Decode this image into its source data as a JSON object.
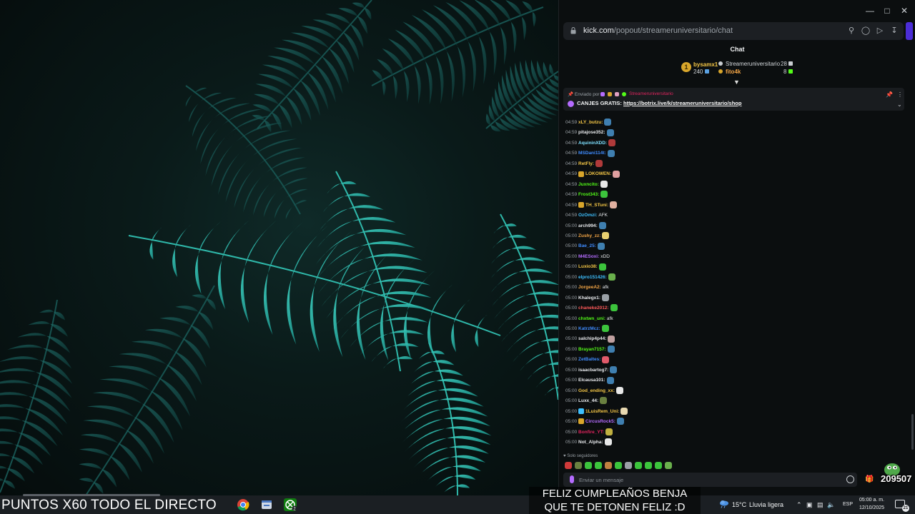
{
  "browser": {
    "url_host": "kick.com",
    "url_path": "/popout/streameruniversitario/chat"
  },
  "chat": {
    "title": "Chat",
    "leaderboard": {
      "rank": "1",
      "left_name": "bysamx1",
      "left_count": "240",
      "right_top_name": "Streameruniversitario",
      "right_top_count": "28",
      "right_bottom_name": "fito4k",
      "right_bottom_count": "8"
    },
    "pinned": {
      "sent_by": "Enviado por",
      "sent_by_user": "Streameruniversitario",
      "label": "CANJES GRATIS:",
      "link": "https://botrix.live/k/streameruniversitario/shop"
    },
    "messages": [
      {
        "time": "04:59",
        "user": "xLY_butzu:",
        "color": "#f4c646",
        "text": "",
        "emote": "#3f7fb0",
        "badge": ""
      },
      {
        "time": "04:59",
        "user": "pitajose352:",
        "color": "#e8eaed",
        "text": "",
        "emote": "#3f7fb0",
        "badge": ""
      },
      {
        "time": "04:59",
        "user": "AquininXDD:",
        "color": "#7ee0ff",
        "text": "",
        "emote": "#b03a3a",
        "badge": ""
      },
      {
        "time": "04:59",
        "user": "MSDani114t:",
        "color": "#3f8cff",
        "text": "",
        "emote": "#3f7fb0",
        "badge": ""
      },
      {
        "time": "04:59",
        "user": "RetFly:",
        "color": "#f4c646",
        "text": "",
        "emote": "#b03a3a",
        "badge": ""
      },
      {
        "time": "04:59",
        "user": "LOKOWEN:",
        "color": "#f4c646",
        "text": "",
        "emote": "#e0a0a0",
        "badge": "#d9a62b"
      },
      {
        "time": "04:59",
        "user": "Juxncito:",
        "color": "#53fc18",
        "text": "",
        "emote": "#e8e8e8",
        "badge": ""
      },
      {
        "time": "04:59",
        "user": "Frost343:",
        "color": "#53fc18",
        "text": "",
        "emote": "#3cc43c",
        "badge": ""
      },
      {
        "time": "04:59",
        "user": "TH_STuni:",
        "color": "#f4c646",
        "text": "",
        "emote": "#e0b0a0",
        "badge": "#d9a62b"
      },
      {
        "time": "04:59",
        "user": "OzOmzi:",
        "color": "#3ec0ff",
        "text": "AFK",
        "emote": "",
        "badge": ""
      },
      {
        "time": "05:00",
        "user": "arch994:",
        "color": "#e8eaed",
        "text": "",
        "emote": "#3f7fb0",
        "badge": ""
      },
      {
        "time": "05:00",
        "user": "Zushy_zz:",
        "color": "#f4a646",
        "text": "",
        "emote": "#e8d070",
        "badge": ""
      },
      {
        "time": "05:00",
        "user": "Bae_25:",
        "color": "#3f8cff",
        "text": "",
        "emote": "#3f7fb0",
        "badge": ""
      },
      {
        "time": "05:00",
        "user": "M4ESoxi:",
        "color": "#b56cff",
        "text": "xDD",
        "emote": "",
        "badge": ""
      },
      {
        "time": "05:00",
        "user": "Luxio38:",
        "color": "#f4c646",
        "text": "",
        "emote": "#3cc43c",
        "badge": ""
      },
      {
        "time": "05:00",
        "user": "elpro151426:",
        "color": "#3ec0ff",
        "text": "",
        "emote": "#6ab04c",
        "badge": ""
      },
      {
        "time": "05:00",
        "user": "JorgeeA2:",
        "color": "#f4a646",
        "text": "afk",
        "emote": "",
        "badge": ""
      },
      {
        "time": "05:00",
        "user": "Khalegx1:",
        "color": "#e8eaed",
        "text": "",
        "emote": "#9aa0a6",
        "badge": ""
      },
      {
        "time": "05:00",
        "user": "chaneke2012:",
        "color": "#ff5a5a",
        "text": "",
        "emote": "#3cc43c",
        "badge": ""
      },
      {
        "time": "05:00",
        "user": "chxtwn_uni:",
        "color": "#53fc18",
        "text": "afk",
        "emote": "",
        "badge": ""
      },
      {
        "time": "05:00",
        "user": "KatrzMcz:",
        "color": "#3f8cff",
        "text": "",
        "emote": "#3cc43c",
        "badge": ""
      },
      {
        "time": "05:00",
        "user": "salchip4p44:",
        "color": "#e8eaed",
        "text": "",
        "emote": "#c0a0a0",
        "badge": ""
      },
      {
        "time": "05:00",
        "user": "Brayan7157:",
        "color": "#53fc18",
        "text": "",
        "emote": "#3f7fb0",
        "badge": ""
      },
      {
        "time": "05:00",
        "user": "ZetBaltes:",
        "color": "#3f8cff",
        "text": "",
        "emote": "#e05a6a",
        "badge": ""
      },
      {
        "time": "05:00",
        "user": "isaacbartog7:",
        "color": "#e8eaed",
        "text": "",
        "emote": "#3f7fb0",
        "badge": ""
      },
      {
        "time": "05:00",
        "user": "Elcausa101:",
        "color": "#e8eaed",
        "text": "",
        "emote": "#3f7fb0",
        "badge": ""
      },
      {
        "time": "05:00",
        "user": "God_ending_xx:",
        "color": "#f4c646",
        "text": "",
        "emote": "#e8e8e8",
        "badge": ""
      },
      {
        "time": "05:00",
        "user": "Luxx_44:",
        "color": "#e8eaed",
        "text": "",
        "emote": "#6a8040",
        "badge": ""
      },
      {
        "time": "05:00",
        "user": "1LuisRem_Uni:",
        "color": "#f4c646",
        "text": "",
        "emote": "#e8d8b0",
        "badge": "#3ec0ff"
      },
      {
        "time": "05:00",
        "user": "CircusRock5:",
        "color": "#b56cff",
        "text": "",
        "emote": "#3f7fb0",
        "badge": "#d9a62b"
      },
      {
        "time": "05:00",
        "user": "Bonfire_YT:",
        "color": "#e0245e",
        "text": "",
        "emote": "#c0b040",
        "badge": ""
      },
      {
        "time": "05:00",
        "user": "Not_Alpha:",
        "color": "#e8eaed",
        "text": "",
        "emote": "#e8e8e8",
        "badge": ""
      }
    ],
    "followers_only": "Solo seguidores",
    "input_placeholder": "Enviar un mensaje",
    "points": "209507"
  },
  "overlay": {
    "left_text": "PUNTOS X60 TODO EL DIRECTO",
    "center_line1": "FELIZ CUMPLEAÑOS BENJA",
    "center_line2": "QUE TE DETONEN FELIZ :D"
  },
  "taskbar": {
    "weather_temp": "15°C",
    "weather_desc": "Lluvia ligera",
    "lang": "ESP",
    "time": "05:00 a. m.",
    "date": "12/10/2025",
    "notifications": "21",
    "xbox_badge": "2"
  },
  "colors": {
    "kick_green": "#53fc18",
    "browser_bg": "#0b0e0f",
    "taskbar_bg": "#1b1f23"
  }
}
